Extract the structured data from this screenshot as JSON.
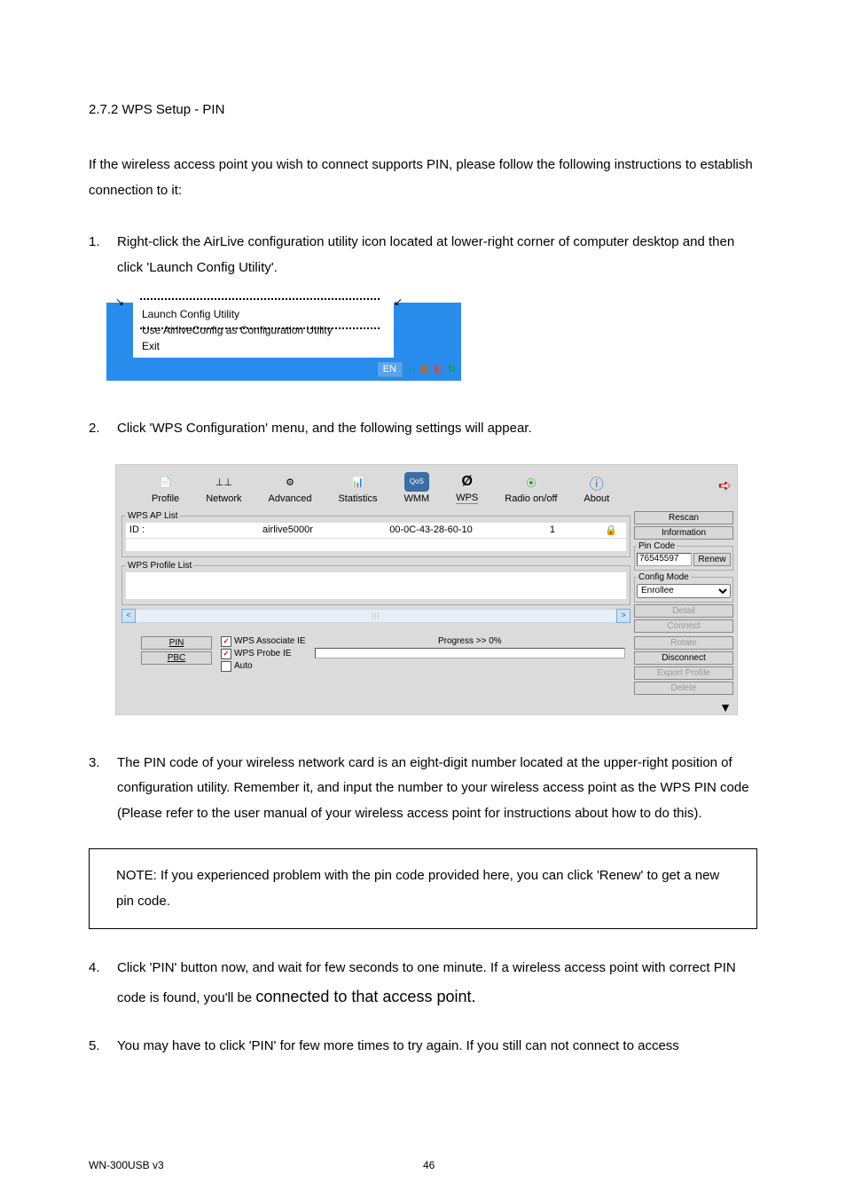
{
  "heading": "2.7.2 WPS Setup - PIN",
  "intro": "If the wireless access point you wish to connect supports PIN, please follow the following instructions to establish connection to it:",
  "steps": {
    "s1": {
      "num": "1.",
      "text": "Right-click the AirLive configuration utility icon located at lower-right corner of computer desktop and then click 'Launch Config Utility'."
    },
    "s2": {
      "num": "2.",
      "text": "Click 'WPS Configuration' menu, and the following settings will appear."
    },
    "s3": {
      "num": "3.",
      "text": "The PIN code of your wireless network card is an eight-digit number located at the upper-right position of configuration utility. Remember it, and input the number to your wireless access point as the WPS PIN code (Please refer to the user manual of your wireless access point for instructions about how to do this)."
    },
    "s4": {
      "num": "4.",
      "text_a": "Click 'PIN' button now, and wait for few seconds to one minute. If a wireless access point with correct PIN code is found, you'll be ",
      "text_b": "connected to that access point."
    },
    "s5": {
      "num": "5.",
      "text": "You may have to click 'PIN' for few more times to try again. If you still can not connect to access"
    }
  },
  "note": "NOTE: If you experienced problem with the pin code provided here, you can click 'Renew' to get a new pin code.",
  "context_menu": {
    "item1": "Launch Config Utility",
    "item2": "Use AirliveConfig as Configuration Utility",
    "item3": "Exit",
    "lang": "EN"
  },
  "wps": {
    "tabs": {
      "profile": "Profile",
      "network": "Network",
      "advanced": "Advanced",
      "statistics": "Statistics",
      "wmm": "WMM",
      "wps": "WPS",
      "radio": "Radio on/off",
      "about": "About"
    },
    "aplist_legend": "WPS AP List",
    "aplist": {
      "id_label": "ID :",
      "ssid": "airlive5000r",
      "mac": "00-0C-43-28-60-10",
      "ch": "1"
    },
    "profilelist_legend": "WPS Profile List",
    "right": {
      "rescan": "Rescan",
      "information": "Information",
      "pincode_legend": "Pin Code",
      "pincode": "76545597",
      "renew": "Renew",
      "configmode_legend": "Config Mode",
      "configmode": "Enrollee",
      "detail": "Detail",
      "connect": "Connect",
      "rotate": "Rotate",
      "disconnect": "Disconnect",
      "export": "Export Profile",
      "delete": "Delete"
    },
    "bottom": {
      "pin": "PIN",
      "pbc": "PBC",
      "wps_assoc": "WPS Associate IE",
      "wps_probe": "WPS Probe IE",
      "auto": "Auto",
      "progress": "Progress >> 0%"
    }
  },
  "footer": {
    "model": "WN-300USB v3",
    "page": "46"
  }
}
